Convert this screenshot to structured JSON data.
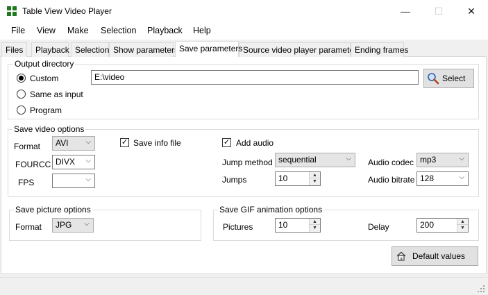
{
  "window": {
    "title": "Table View Video Player",
    "minimize": "—",
    "maximize": "☐",
    "close": "✕"
  },
  "menu": [
    "File",
    "View",
    "Make",
    "Selection",
    "Playback",
    "Help"
  ],
  "tabs": [
    "Files",
    "Playback",
    "Selection",
    "Show parameters",
    "Save parameters",
    "Source video player parameters",
    "Ending frames"
  ],
  "active_tab": "Save parameters",
  "output_directory": {
    "title": "Output directory",
    "options": [
      "Custom",
      "Same as input",
      "Program"
    ],
    "selected": "Custom",
    "path": "E:\\video",
    "select_button": "Select"
  },
  "save_video": {
    "title": "Save video options",
    "format_label": "Format",
    "format_value": "AVI",
    "fourcc_label": "FOURCC",
    "fourcc_value": "DIVX",
    "fps_label": "FPS",
    "fps_value": "",
    "save_info_label": "Save info file",
    "save_info_checked": true,
    "add_audio_label": "Add audio",
    "add_audio_checked": true,
    "jump_method_label": "Jump method",
    "jump_method_value": "sequential",
    "jumps_label": "Jumps",
    "jumps_value": "10",
    "audio_codec_label": "Audio codec",
    "audio_codec_value": "mp3",
    "audio_bitrate_label": "Audio bitrate",
    "audio_bitrate_value": "128"
  },
  "save_picture": {
    "title": "Save picture options",
    "format_label": "Format",
    "format_value": "JPG"
  },
  "save_gif": {
    "title": "Save GIF animation options",
    "pictures_label": "Pictures",
    "pictures_value": "10",
    "delay_label": "Delay",
    "delay_value": "200"
  },
  "default_values_button": "Default values",
  "icons": {
    "check_mark": "✓",
    "dropdown_arrow": "⌵",
    "spin_up": "▲",
    "spin_down": "▼"
  }
}
